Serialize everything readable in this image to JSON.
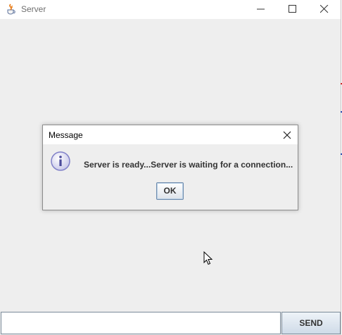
{
  "window": {
    "title": "Server",
    "icon": "java-cup-icon",
    "controls": [
      "minimize-icon",
      "maximize-icon",
      "close-icon"
    ]
  },
  "dialog": {
    "title": "Message",
    "icon": "info-icon",
    "message": "Server is ready...Server is waiting for a connection...",
    "ok_label": "OK",
    "close_icon": "close-icon"
  },
  "footer": {
    "input_value": "",
    "send_label": "SEND"
  },
  "colors": {
    "window_bg": "#eeeeee",
    "titlebar_bg": "#ffffff",
    "button_border": "#6f8cad",
    "info_icon": "#8080c8"
  }
}
